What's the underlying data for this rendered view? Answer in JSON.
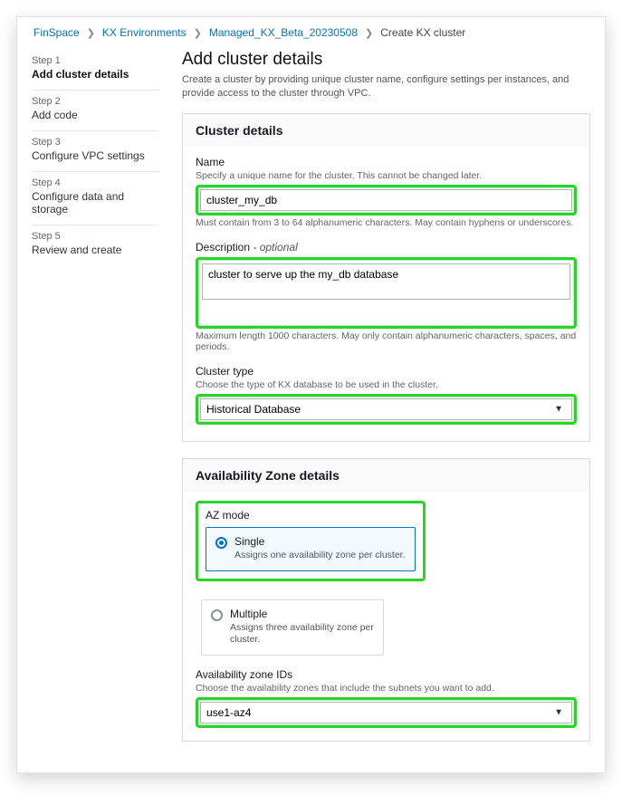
{
  "breadcrumbs": {
    "items": [
      "FinSpace",
      "KX Environments",
      "Managed_KX_Beta_20230508"
    ],
    "current": "Create KX cluster"
  },
  "steps": [
    {
      "num": "Step 1",
      "title": "Add cluster details"
    },
    {
      "num": "Step 2",
      "title": "Add code"
    },
    {
      "num": "Step 3",
      "title": "Configure VPC settings"
    },
    {
      "num": "Step 4",
      "title": "Configure data and storage"
    },
    {
      "num": "Step 5",
      "title": "Review and create"
    }
  ],
  "header": {
    "title": "Add cluster details",
    "subtitle": "Create a cluster by providing unique cluster name, configure settings per instances, and provide access to the cluster through VPC."
  },
  "cluster_details": {
    "panel_title": "Cluster details",
    "name": {
      "label": "Name",
      "hint": "Specify a unique name for the cluster. This cannot be changed later.",
      "value": "cluster_my_db",
      "under": "Must contain from 3 to 64 alphanumeric characters. May contain hyphens or underscores."
    },
    "desc": {
      "label": "Description",
      "optional": "- optional",
      "value": "cluster to serve up the my_db database",
      "under": "Maximum length 1000 characters. May only contain alphanumeric characters, spaces, and periods."
    },
    "type": {
      "label": "Cluster type",
      "hint": "Choose the type of KX database to be used in the cluster.",
      "value": "Historical Database"
    }
  },
  "az": {
    "panel_title": "Availability Zone details",
    "mode_label": "AZ mode",
    "single": {
      "title": "Single",
      "desc": "Assigns one availability zone per cluster."
    },
    "multiple": {
      "title": "Multiple",
      "desc": "Assigns three availability zone per cluster."
    },
    "ids": {
      "label": "Availability zone IDs",
      "hint": "Choose the availability zones that include the subnets you want to add.",
      "value": "use1-az4"
    }
  }
}
